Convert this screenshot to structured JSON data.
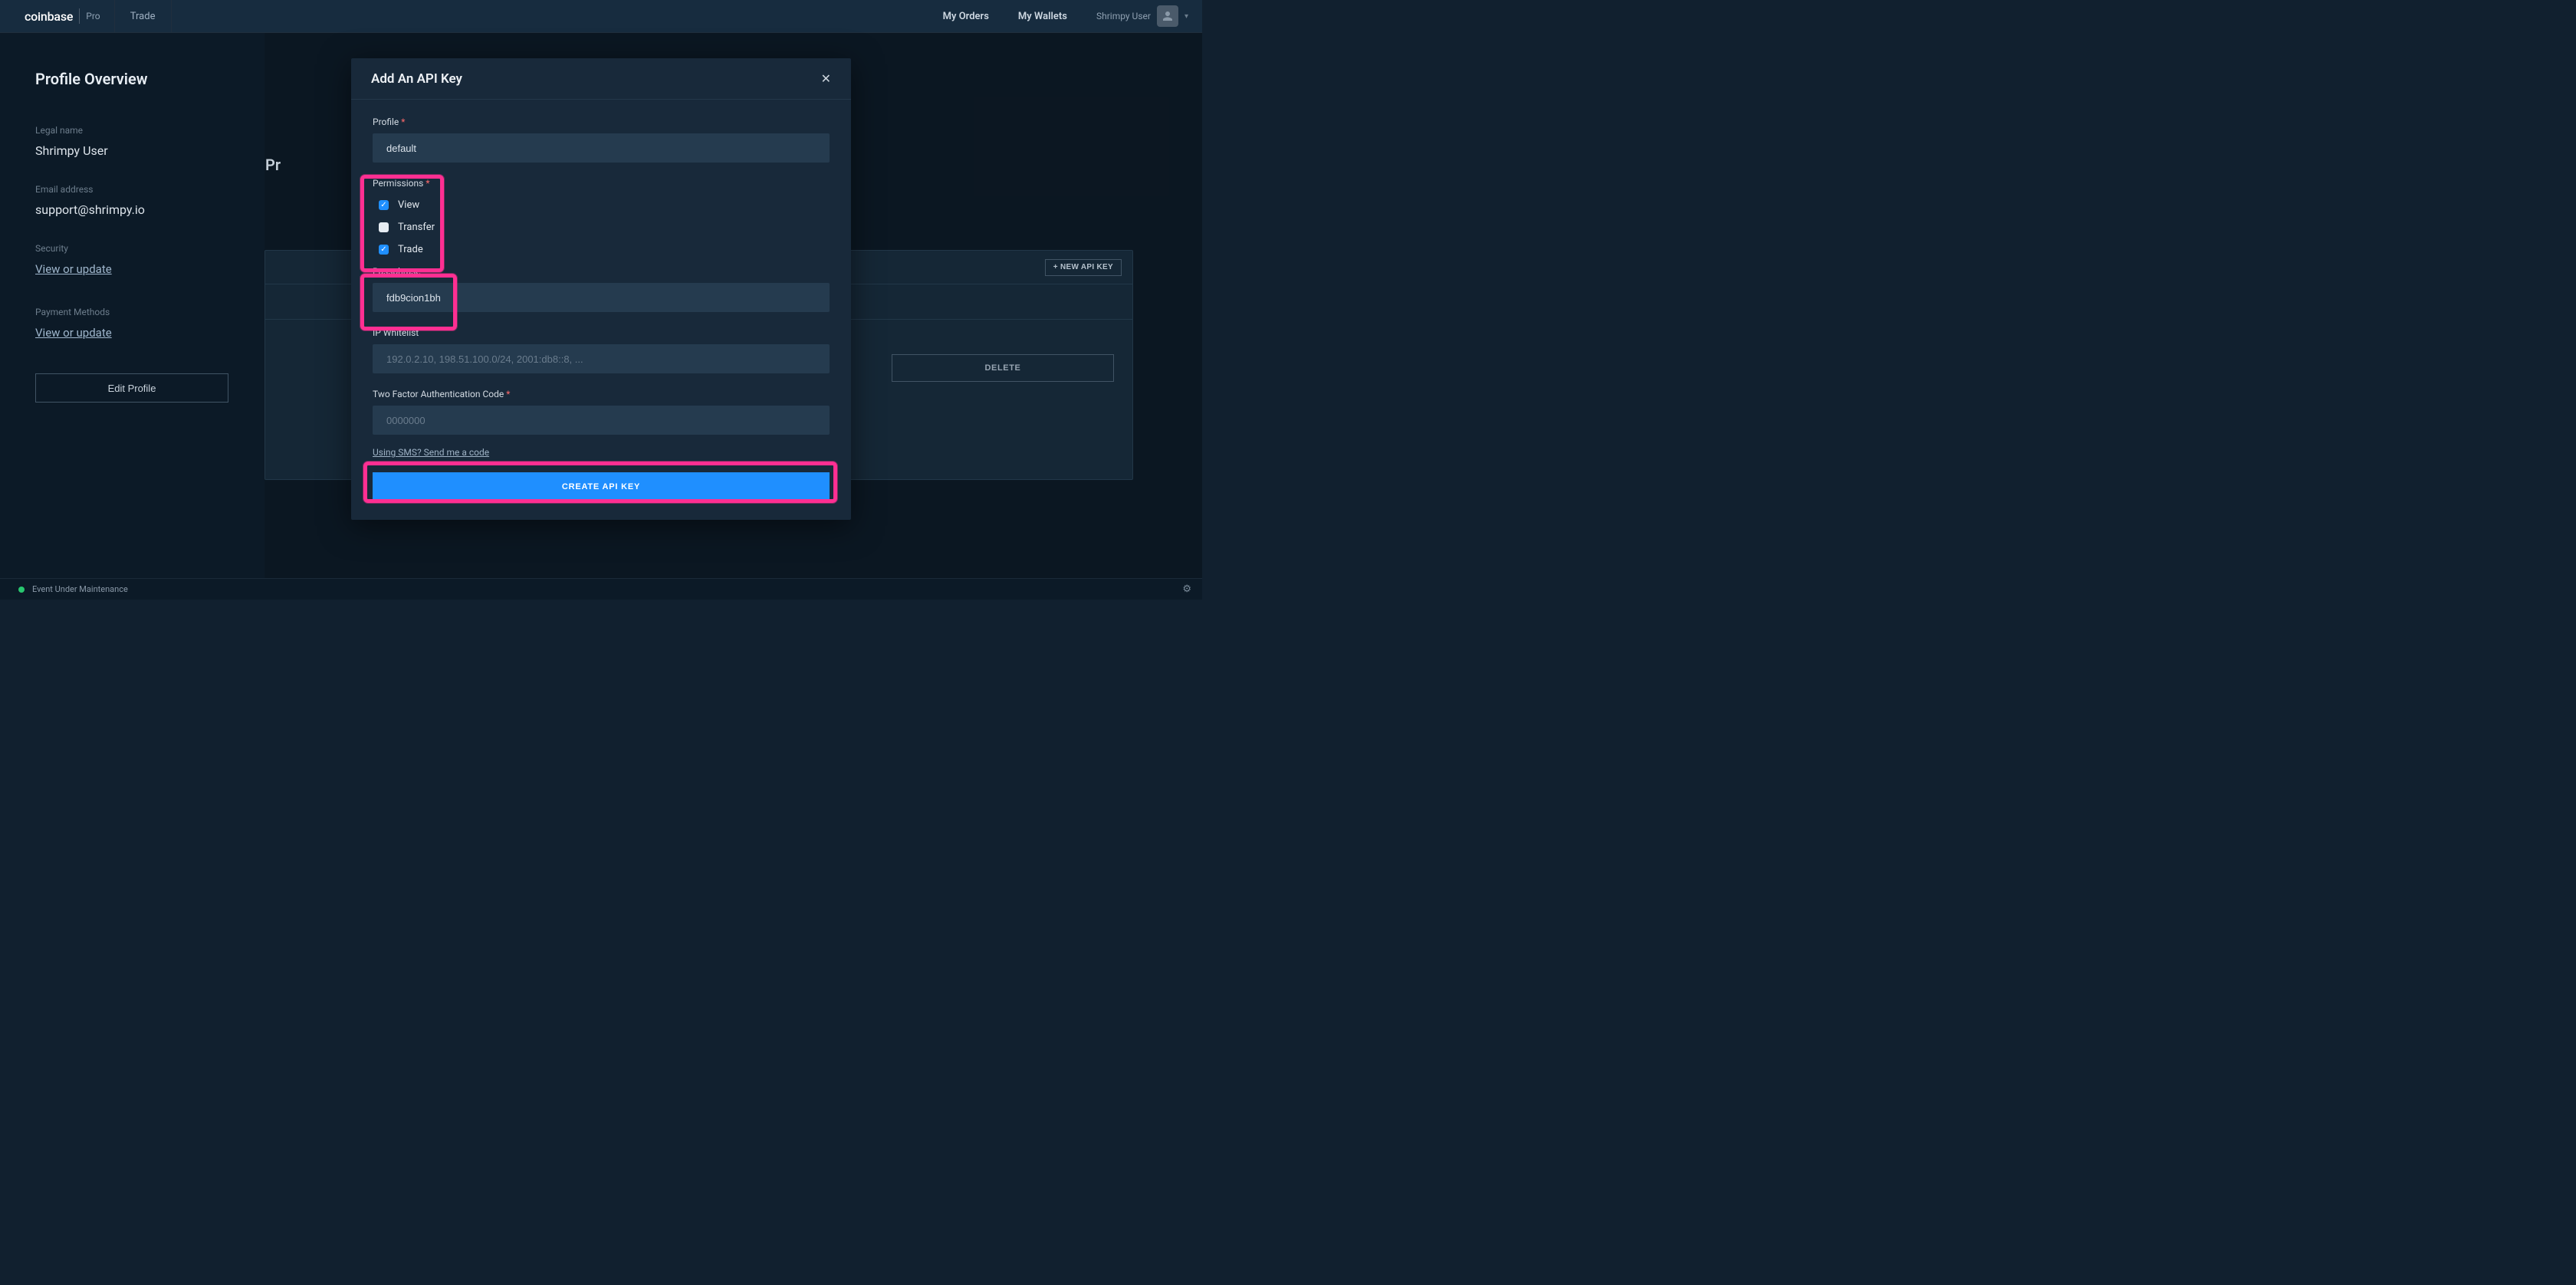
{
  "header": {
    "logo_main": "coinbase",
    "logo_sub": "Pro",
    "nav_trade": "Trade",
    "my_orders": "My Orders",
    "my_wallets": "My Wallets",
    "username": "Shrimpy User"
  },
  "sidebar": {
    "title": "Profile Overview",
    "legal_name_label": "Legal name",
    "legal_name_value": "Shrimpy User",
    "email_label": "Email address",
    "email_value": "support@shrimpy.io",
    "security_label": "Security",
    "security_link": "View or update",
    "payment_label": "Payment Methods",
    "payment_link": "View or update",
    "edit_button": "Edit Profile"
  },
  "content": {
    "page_title_truncated": "Pr",
    "new_api_key_button": "+ NEW API KEY",
    "delete_button": "DELETE"
  },
  "modal": {
    "title": "Add An API Key",
    "profile_label": "Profile",
    "profile_value": "default",
    "permissions_label": "Permissions",
    "perm_view": "View",
    "perm_transfer": "Transfer",
    "perm_trade": "Trade",
    "passphrase_label": "Passphrase",
    "passphrase_value": "fdb9cion1bh",
    "ip_label": "IP Whitelist",
    "ip_placeholder": "192.0.2.10, 198.51.100.0/24, 2001:db8::8, ...",
    "tfa_label": "Two Factor Authentication Code",
    "tfa_placeholder": "0000000",
    "sms_link": "Using SMS? Send me a code",
    "create_button": "CREATE API KEY"
  },
  "footer": {
    "status_text": "Event Under Maintenance"
  }
}
